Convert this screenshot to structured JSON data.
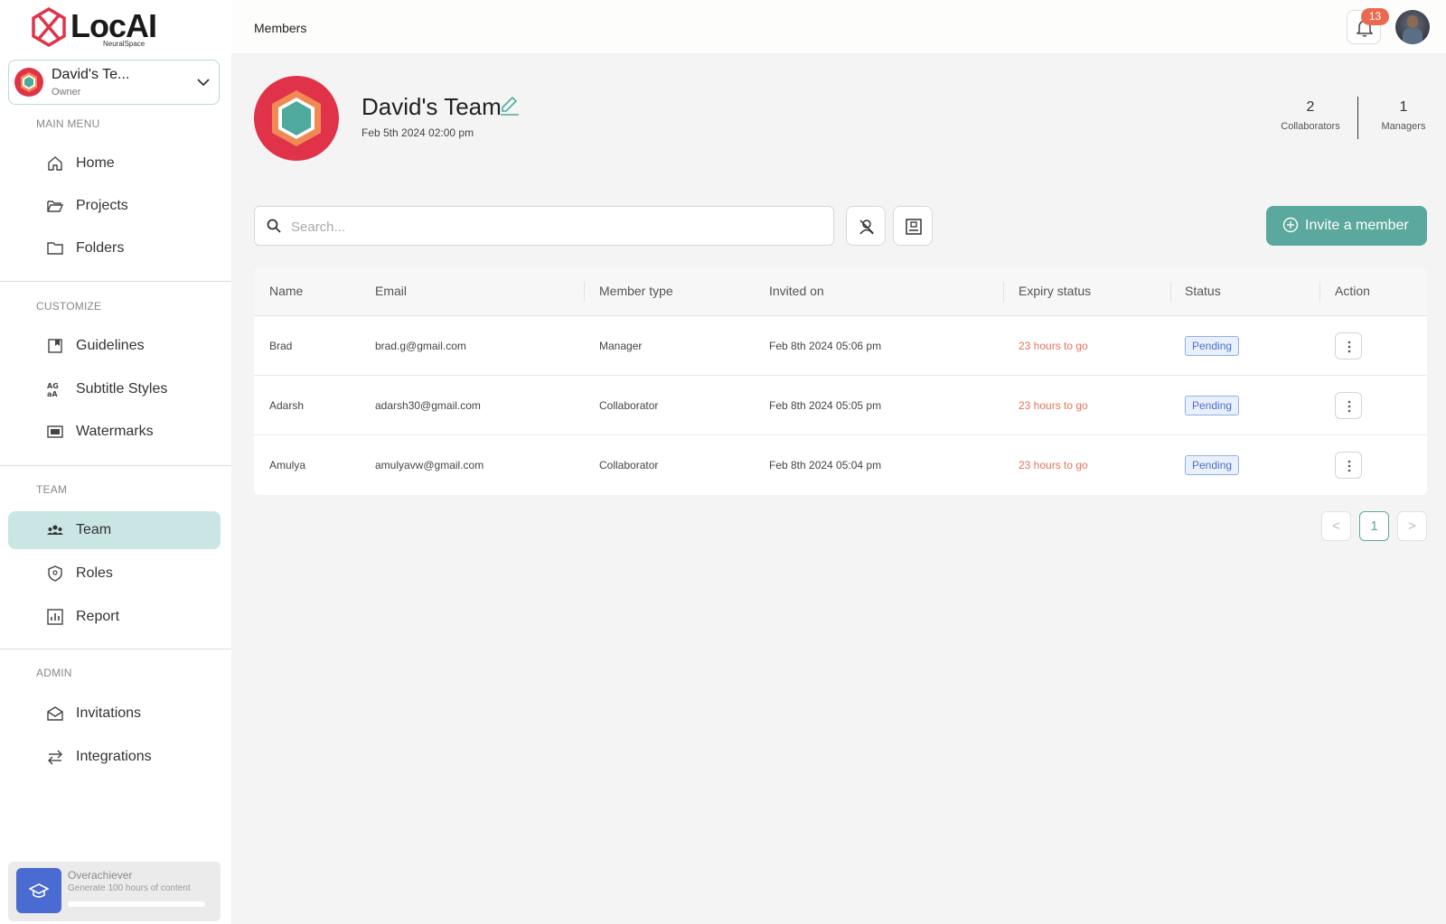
{
  "app": {
    "brand": "LocAI",
    "brand_sub": "NeuralSpace"
  },
  "team_switcher": {
    "name": "David's Te...",
    "role": "Owner"
  },
  "sidebar": {
    "main_menu_label": "MAIN MENU",
    "main_items": [
      {
        "label": "Home",
        "icon": "home-icon"
      },
      {
        "label": "Projects",
        "icon": "folder-open-icon"
      },
      {
        "label": "Folders",
        "icon": "folder-icon"
      }
    ],
    "customize_label": "CUSTOMIZE",
    "customize_items": [
      {
        "label": "Guidelines",
        "icon": "bookmark-icon"
      },
      {
        "label": "Subtitle Styles",
        "icon": "font-style-icon"
      },
      {
        "label": "Watermarks",
        "icon": "watermark-icon"
      }
    ],
    "team_label": "TEAM",
    "team_items": [
      {
        "label": "Team",
        "icon": "team-icon",
        "active": true
      },
      {
        "label": "Roles",
        "icon": "shield-icon"
      },
      {
        "label": "Report",
        "icon": "chart-icon"
      }
    ],
    "admin_label": "ADMIN",
    "admin_items": [
      {
        "label": "Invitations",
        "icon": "envelope-icon"
      },
      {
        "label": "Integrations",
        "icon": "arrows-icon"
      }
    ]
  },
  "achievement": {
    "title": "Overachiever",
    "desc": "Generate 100 hours of content",
    "progress": 0
  },
  "topbar": {
    "breadcrumb": "Members",
    "notifications": "13"
  },
  "team": {
    "title": "David's Team",
    "created": "Feb 5th 2024 02:00 pm",
    "collaborators_count": "2",
    "collaborators_label": "Collaborators",
    "managers_count": "1",
    "managers_label": "Managers"
  },
  "search": {
    "placeholder": "Search...",
    "value": ""
  },
  "invite_label": "Invite a member",
  "table": {
    "headers": [
      "Name",
      "Email",
      "Member type",
      "Invited on",
      "Expiry status",
      "Status",
      "Action"
    ],
    "rows": [
      {
        "name": "Brad",
        "email": "brad.g@gmail.com",
        "type": "Manager",
        "invited": "Feb 8th 2024 05:06 pm",
        "expiry": "23 hours to go",
        "status": "Pending"
      },
      {
        "name": "Adarsh",
        "email": "adarsh30@gmail.com",
        "type": "Collaborator",
        "invited": "Feb 8th 2024 05:05 pm",
        "expiry": "23 hours to go",
        "status": "Pending"
      },
      {
        "name": "Amulya",
        "email": "amulyavw@gmail.com",
        "type": "Collaborator",
        "invited": "Feb 8th 2024 05:04 pm",
        "expiry": "23 hours to go",
        "status": "Pending"
      }
    ]
  },
  "pagination": {
    "prev": "<",
    "current": "1",
    "next": ">"
  },
  "colors": {
    "accent": "#5ba89e",
    "active_nav": "#c9e5e4",
    "expiry": "#e6735a",
    "badge": "#ea6a4f",
    "brand_red": "#e0334a"
  }
}
